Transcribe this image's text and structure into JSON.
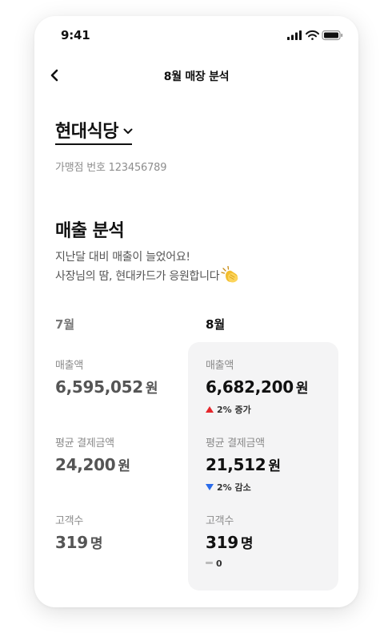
{
  "status_bar": {
    "time": "9:41"
  },
  "nav": {
    "title": "8월 매장 분석"
  },
  "store": {
    "name": "현대식당",
    "merchant_no": "가맹점 번호 123456789"
  },
  "analysis": {
    "title": "매출 분석",
    "desc_line1": "지난달 대비 매출이 늘었어요!",
    "desc_line2": "사장님의 땀, 현대카드가 응원합니다"
  },
  "prev_month": {
    "label": "7월",
    "sales_label": "매출액",
    "sales_value": "6,595,052",
    "sales_unit": "원",
    "avg_label": "평균 결제금액",
    "avg_value": "24,200",
    "avg_unit": "원",
    "cust_label": "고객수",
    "cust_value": "319",
    "cust_unit": "명"
  },
  "cur_month": {
    "label": "8월",
    "sales_label": "매출액",
    "sales_value": "6,682,200",
    "sales_unit": "원",
    "sales_change": "2% 증가",
    "avg_label": "평균 결제금액",
    "avg_value": "21,512",
    "avg_unit": "원",
    "avg_change": "2% 감소",
    "cust_label": "고객수",
    "cust_value": "319",
    "cust_unit": "명",
    "cust_change": "0"
  },
  "colors": {
    "increase": "#e5262b",
    "decrease": "#2a6bea",
    "neutral": "#bbbbbb",
    "highlight_bg": "#f4f4f5"
  },
  "icons": [
    "back-arrow-icon",
    "chevron-down-icon",
    "signal-icon",
    "wifi-icon",
    "battery-icon",
    "clapping-hands-icon"
  ]
}
